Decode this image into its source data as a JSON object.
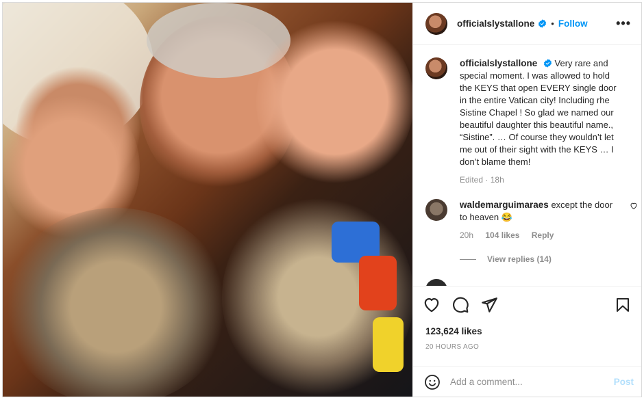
{
  "post": {
    "username": "officialslystallone",
    "follow_label": "Follow",
    "more_label": "•••",
    "caption": "Very rare and special moment. I was allowed to hold the KEYS that open EVERY single door in the entire Vatican city! Including rhe Sistine Chapel ! So glad we named our beautiful daughter this beautiful name., “Sistine”. … Of course they wouldn’t let me out of their sight with the KEYS … I don’t blame them!",
    "edited_label": "Edited",
    "edited_time": "18h",
    "likes": "123,624 likes",
    "timestamp": "20 HOURS AGO"
  },
  "comment": {
    "username": "waldemarguimaraes",
    "text": "except the door to heaven 😂",
    "time": "20h",
    "likes": "104 likes",
    "reply_label": "Reply",
    "view_replies": "View replies (14)"
  },
  "add_comment": {
    "placeholder": "Add a comment...",
    "post_label": "Post"
  },
  "icons": {
    "verified": "verified-badge-icon",
    "like": "heart-icon",
    "comment": "comment-bubble-icon",
    "share": "paper-plane-icon",
    "save": "bookmark-icon",
    "emoji": "smiley-icon",
    "more": "more-options-icon"
  },
  "colors": {
    "accent": "#0095f6",
    "muted": "#8e8e8e",
    "text": "#262626"
  }
}
